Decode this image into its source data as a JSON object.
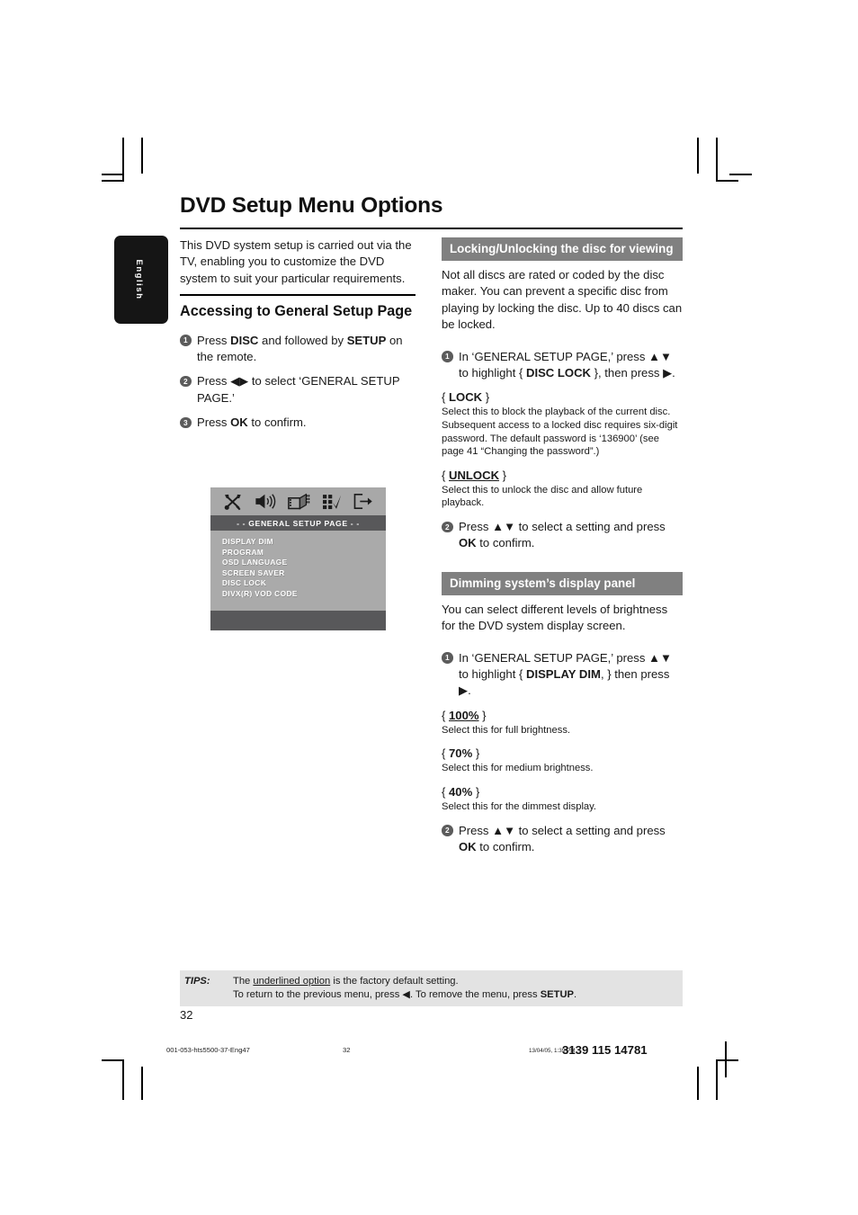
{
  "document": {
    "title": "DVD Setup Menu Options",
    "language_tab": "English",
    "page_number": "32"
  },
  "left_column": {
    "intro": "This DVD system setup is carried out via the TV, enabling you to customize the DVD system to suit your particular requirements.",
    "section_heading": "Accessing to General Setup Page",
    "steps": [
      {
        "num": "1",
        "html": "Press <b>DISC</b> and followed by <b>SETUP</b> on the remote."
      },
      {
        "num": "2",
        "html": "Press ◀▶ to select ‘GENERAL SETUP PAGE.’"
      },
      {
        "num": "3",
        "html": "Press <b>OK</b> to confirm."
      }
    ]
  },
  "osd_mock": {
    "icons": [
      "tools-icon",
      "speaker-icon",
      "video-icon",
      "preferences-icon",
      "exit-icon"
    ],
    "title": "- -  GENERAL  SETUP  PAGE  - -",
    "items": [
      "DISPLAY DIM",
      "PROGRAM",
      "OSD LANGUAGE",
      "SCREEN SAVER",
      "DISC LOCK",
      "DIVX(R) VOD CODE"
    ]
  },
  "right_column": {
    "section_lock": {
      "band": "Locking/Unlocking the disc for viewing",
      "intro": "Not all discs are rated or coded by the disc maker. You can prevent a specific disc from playing by locking the disc.  Up to 40 discs can be locked.",
      "step1": {
        "num": "1",
        "html": "In ‘GENERAL SETUP PAGE,’ press ▲▼ to highlight { <b>DISC LOCK</b> }, then press ▶."
      },
      "options": [
        {
          "name_html": "{ <b>LOCK</b> }",
          "desc": "Select this to block the playback of the current disc.  Subsequent access to a locked disc requires six-digit password. The default password is ‘136900’ (see page 41 “Changing the password”.)"
        },
        {
          "name_html": "{ <b><u>UNLOCK</u></b> }",
          "desc": "Select this to unlock the disc and allow future playback."
        }
      ],
      "step2": {
        "num": "2",
        "html": "Press ▲▼ to select a setting and press <b>OK</b> to confirm."
      }
    },
    "section_dim": {
      "band": "Dimming system’s display panel",
      "intro": "You can select different levels of brightness for the DVD system display screen.",
      "step1": {
        "num": "1",
        "html": "In ‘GENERAL SETUP PAGE,’ press ▲▼ to highlight { <b>DISPLAY DIM</b>, } then press ▶."
      },
      "options": [
        {
          "name_html": "{ <b><u>100%</u></b> }",
          "desc": "Select this for full brightness."
        },
        {
          "name_html": "{ <b>70%</b> }",
          "desc": "Select this for medium brightness."
        },
        {
          "name_html": "{ <b>40%</b> }",
          "desc": "Select this for the dimmest display."
        }
      ],
      "step2": {
        "num": "2",
        "html": "Press ▲▼ to select a setting and press <b>OK</b> to confirm."
      }
    }
  },
  "tips": {
    "label": "TIPS:",
    "line1_html": "The <u>underlined option</u> is the factory default setting.",
    "line2_html": "To return to the previous menu, press ◀. To remove the menu, press <b>SETUP</b>."
  },
  "print_footer": {
    "filename": "001-053-hts5500-37-Eng47",
    "page": "32",
    "datestamp": "13/04/05, 1:39 PM",
    "code": "3139 115 14781"
  },
  "colors": {
    "band_gray": "#808080",
    "osd_bg": "#aaaaaa",
    "osd_bar": "#58585a",
    "tips_bg": "#e3e3e3",
    "bullet": "#5b5b5b"
  }
}
